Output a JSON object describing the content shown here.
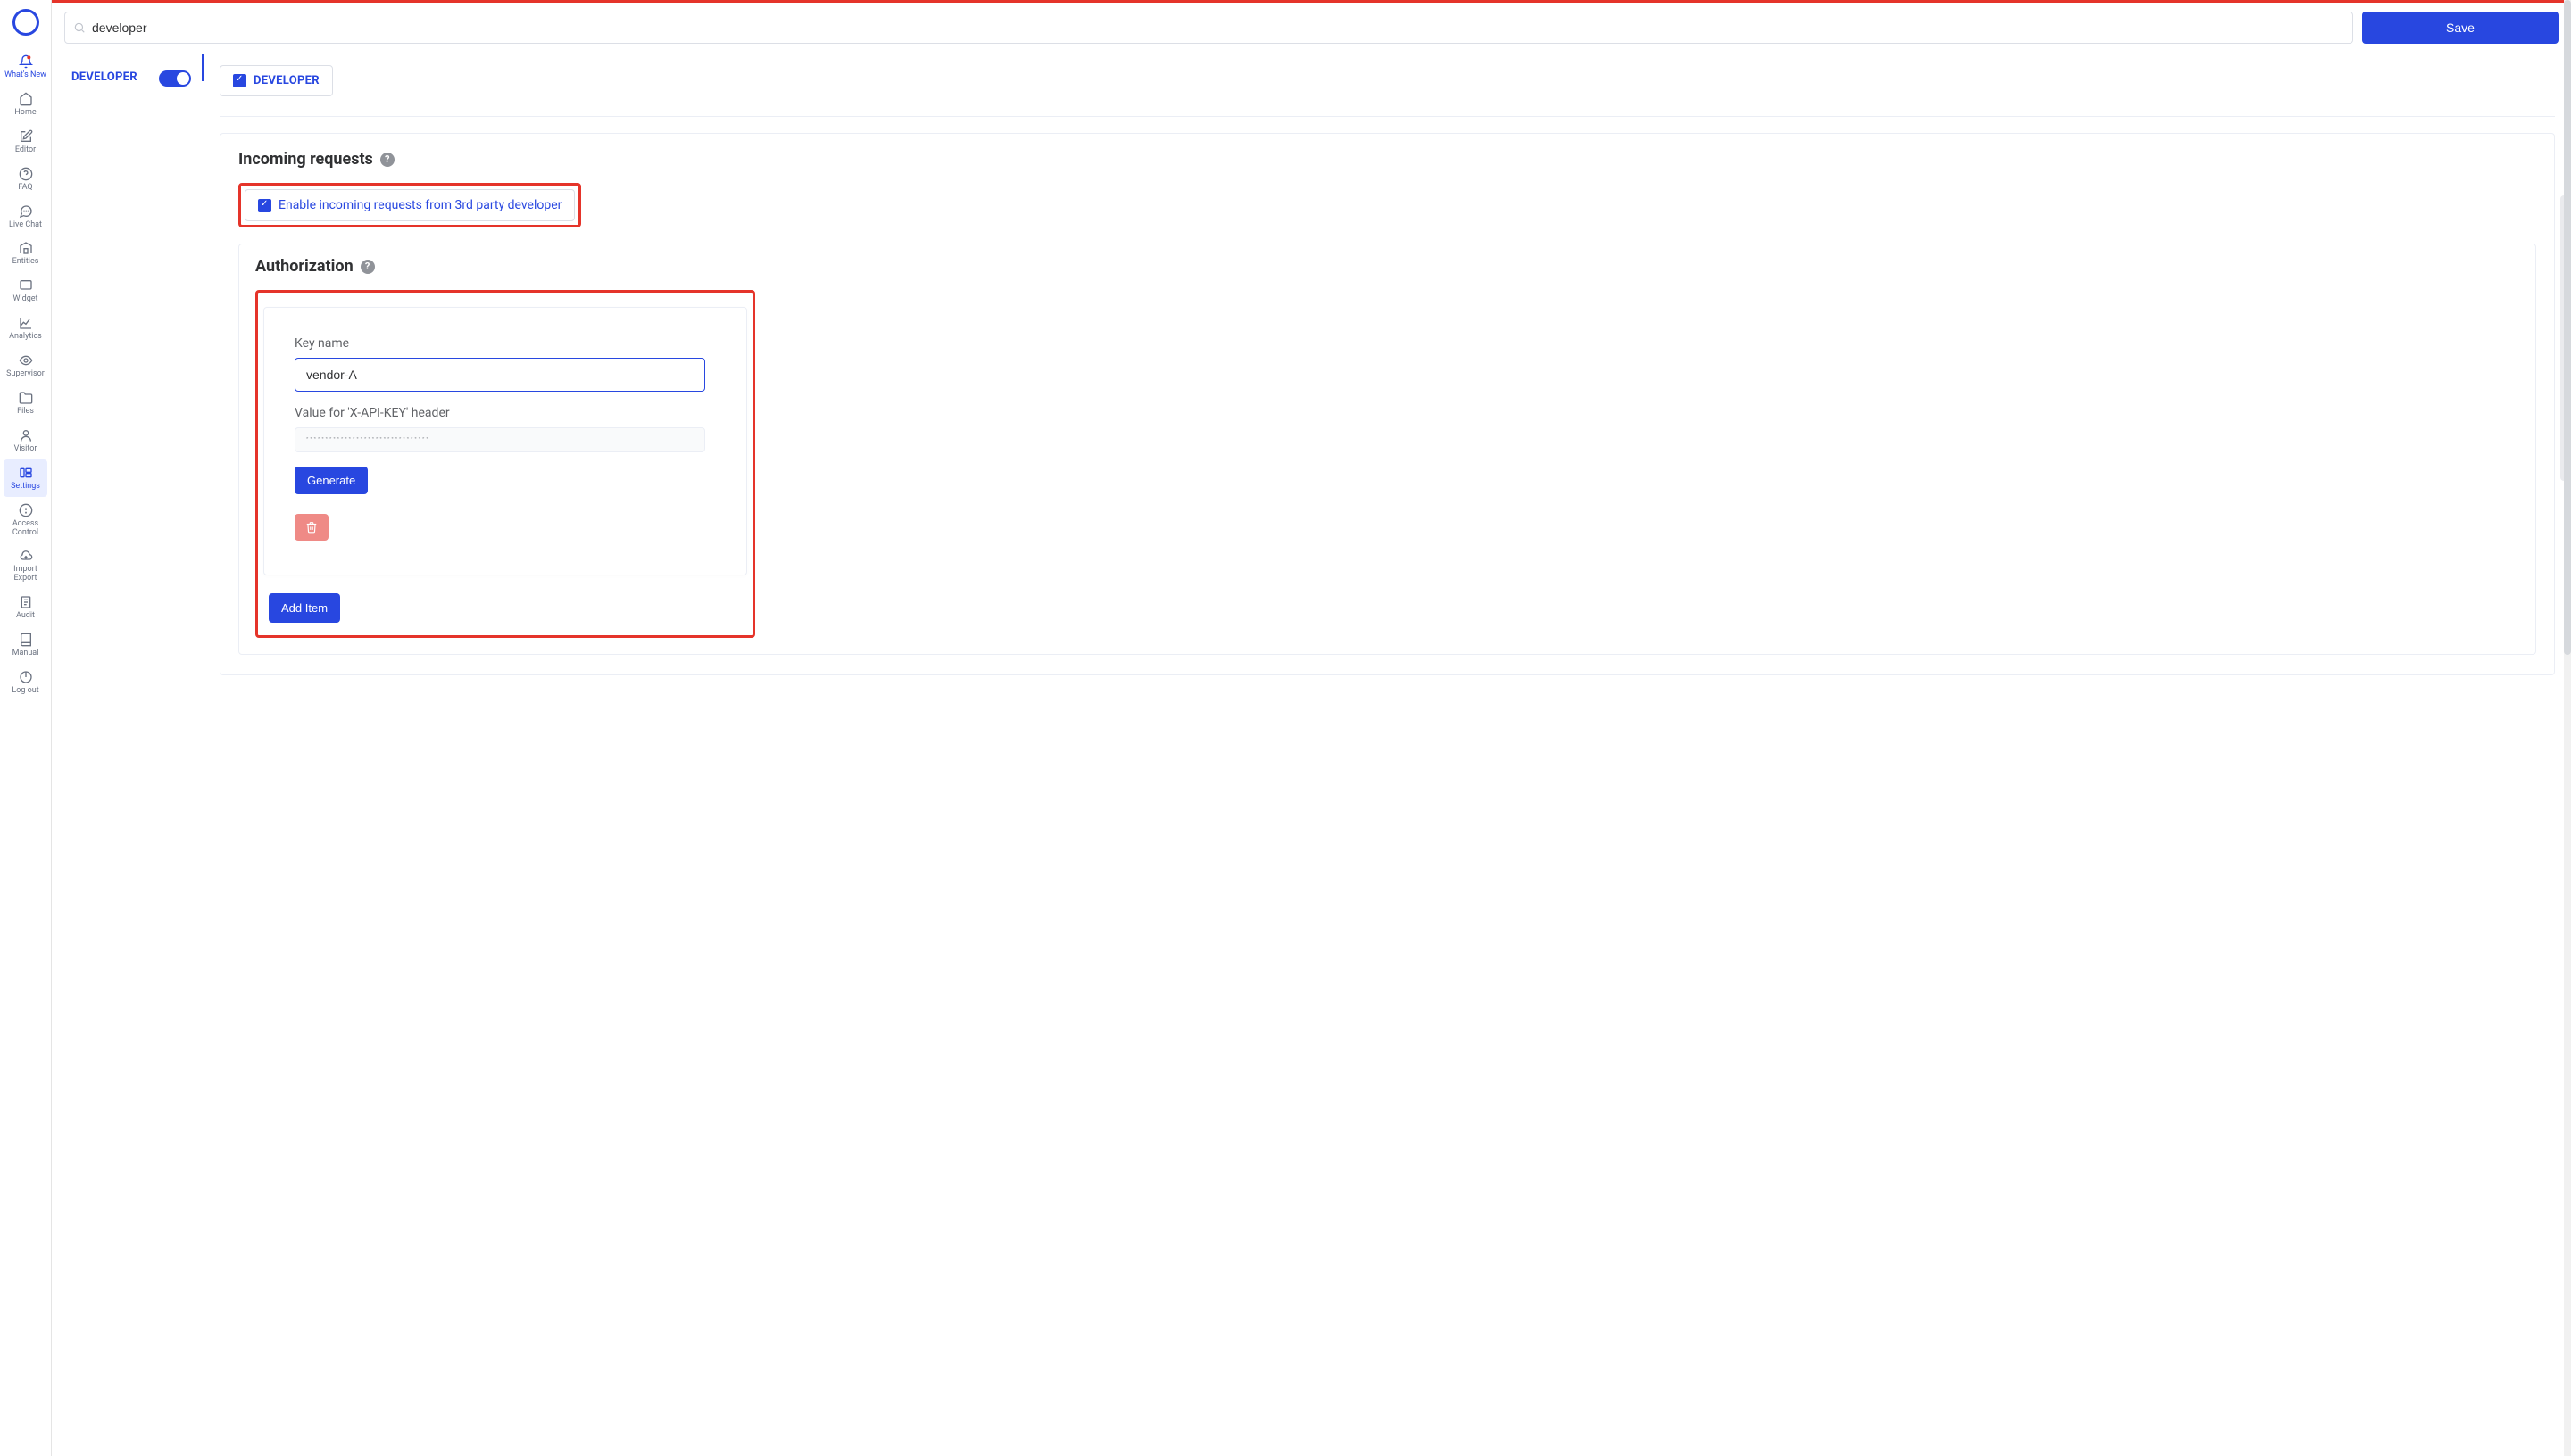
{
  "rail": {
    "items": [
      {
        "label": "What's New",
        "icon": "bell-icon",
        "active": false,
        "accent": true
      },
      {
        "label": "Home",
        "icon": "home-icon",
        "active": false
      },
      {
        "label": "Editor",
        "icon": "editor-icon",
        "active": false
      },
      {
        "label": "FAQ",
        "icon": "faq-icon",
        "active": false
      },
      {
        "label": "Live Chat",
        "icon": "chat-icon",
        "active": false
      },
      {
        "label": "Entities",
        "icon": "entities-icon",
        "active": false
      },
      {
        "label": "Widget",
        "icon": "widget-icon",
        "active": false
      },
      {
        "label": "Analytics",
        "icon": "analytics-icon",
        "active": false
      },
      {
        "label": "Supervisor",
        "icon": "supervisor-icon",
        "active": false
      },
      {
        "label": "Files",
        "icon": "files-icon",
        "active": false
      },
      {
        "label": "Visitor",
        "icon": "visitor-icon",
        "active": false
      },
      {
        "label": "Settings",
        "icon": "settings-icon",
        "active": true
      },
      {
        "label": "Access Control",
        "icon": "access-icon",
        "active": false
      },
      {
        "label": "Import Export",
        "icon": "import-icon",
        "active": false
      },
      {
        "label": "Audit",
        "icon": "audit-icon",
        "active": false
      },
      {
        "label": "Manual",
        "icon": "manual-icon",
        "active": false
      },
      {
        "label": "Log out",
        "icon": "logout-icon",
        "active": false
      }
    ]
  },
  "topbar": {
    "search_value": "developer",
    "save_label": "Save"
  },
  "leftpanel": {
    "label": "DEVELOPER",
    "toggle_on": true
  },
  "chip_developer": {
    "label": "DEVELOPER",
    "checked": true
  },
  "sections": {
    "incoming_title": "Incoming requests",
    "enable_incoming_label": "Enable incoming requests from 3rd party developer",
    "enable_incoming_checked": true,
    "auth_title": "Authorization",
    "key_name_label": "Key name",
    "key_name_value": "vendor-A",
    "api_key_label": "Value for 'X-API-KEY' header",
    "api_key_value": "********************************",
    "generate_label": "Generate",
    "add_item_label": "Add Item"
  }
}
